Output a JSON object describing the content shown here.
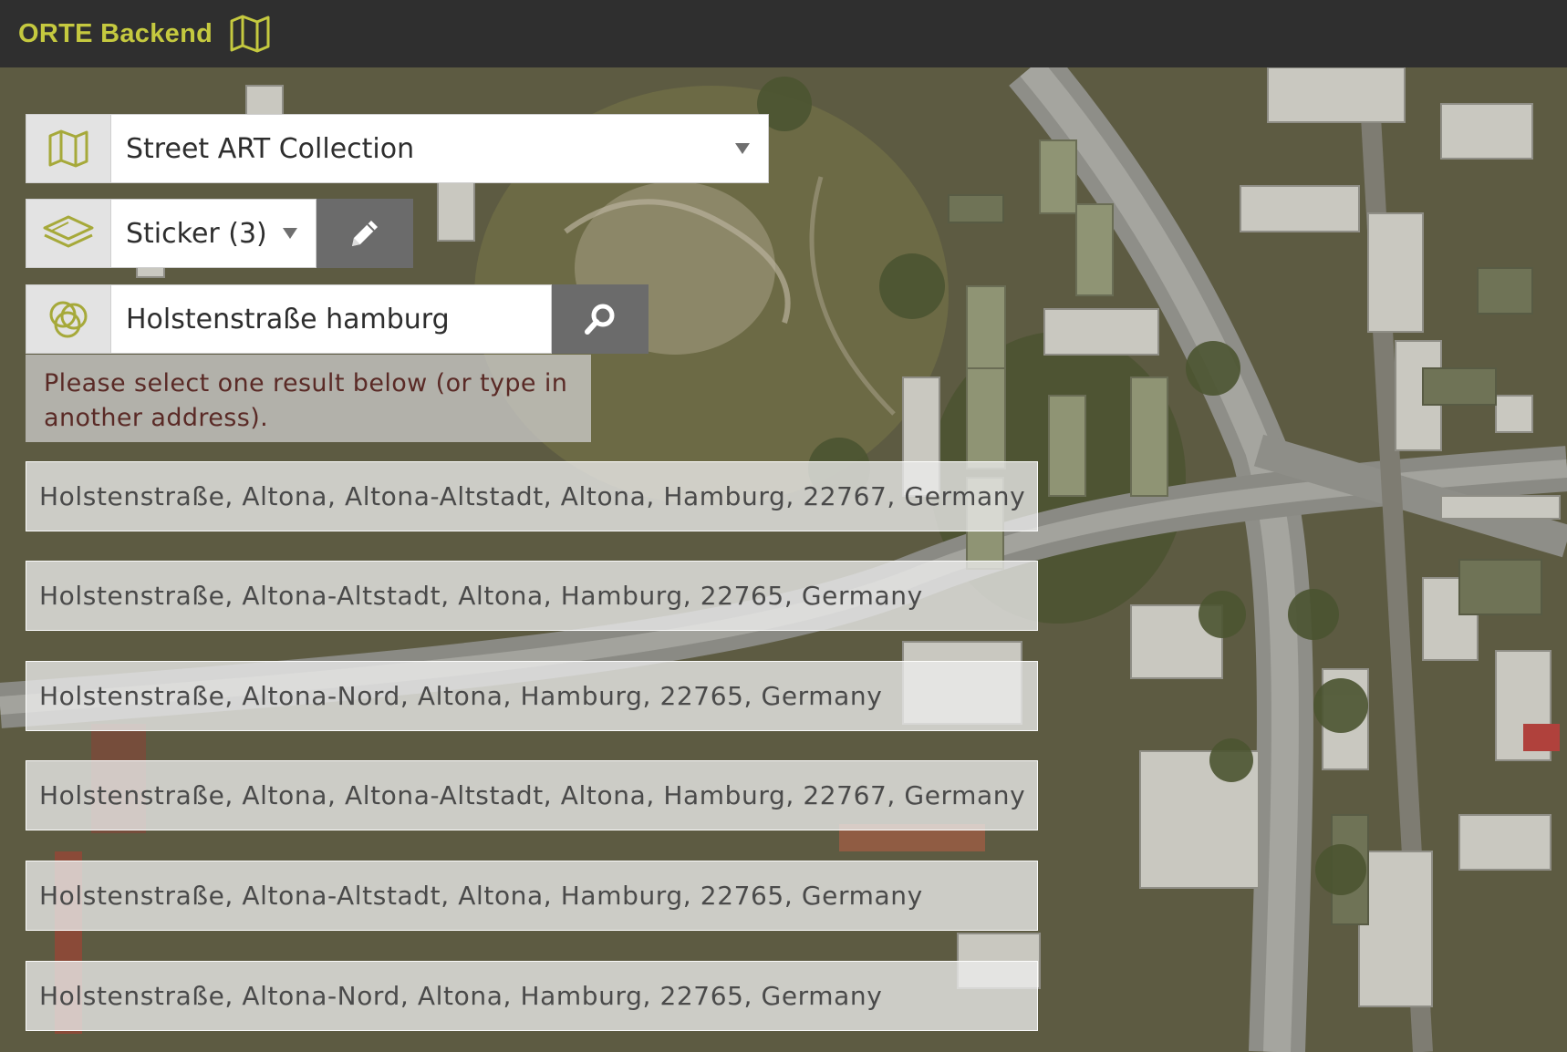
{
  "header": {
    "title": "ORTE Backend",
    "brand_icon": "map-icon",
    "title_color": "#c5c93f"
  },
  "collection_select": {
    "icon": "map-icon",
    "value": "Street ART Collection"
  },
  "layer_select": {
    "icon": "layers-icon",
    "value": "Sticker (3)",
    "edit_icon": "pencil-icon"
  },
  "address_search": {
    "icon": "circles-icon",
    "value": "Holstenstraße hamburg",
    "search_icon": "search-icon"
  },
  "hint": "Please select one result below (or type in another address).",
  "results": [
    "Holstenstraße, Altona, Altona-Altstadt, Altona, Hamburg, 22767, Germany",
    "Holstenstraße, Altona-Altstadt, Altona, Hamburg, 22765, Germany",
    "Holstenstraße, Altona-Nord, Altona, Hamburg, 22765, Germany",
    "Holstenstraße, Altona, Altona-Altstadt, Altona, Hamburg, 22767, Germany",
    "Holstenstraße, Altona-Altstadt, Altona, Hamburg, 22765, Germany",
    "Holstenstraße, Altona-Nord, Altona, Hamburg, 22765, Germany"
  ],
  "colors": {
    "topbar": "#2f2f2f",
    "accent": "#c5c93f",
    "hint_text": "#5a2a26",
    "button_dark": "#6b6b6b"
  }
}
